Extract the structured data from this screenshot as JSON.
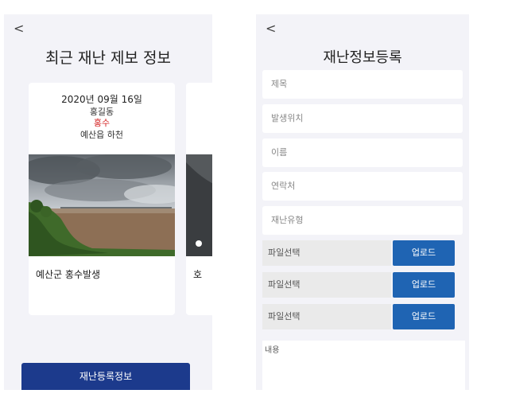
{
  "left": {
    "back": "<",
    "title": "최근 재난 제보 정보",
    "cards": [
      {
        "date": "2020년 09월 16일",
        "name": "홍길동",
        "type": "홍수",
        "location": "예산읍 하천",
        "caption": "예산군 홍수발생"
      },
      {
        "caption": "호"
      }
    ],
    "register_button": "재난등록정보"
  },
  "right": {
    "back": "<",
    "title": "재난정보등록",
    "fields": [
      "제목",
      "발생위치",
      "이름",
      "연락처",
      "재난유형"
    ],
    "files": [
      {
        "label": "파일선택",
        "button": "업로드"
      },
      {
        "label": "파일선택",
        "button": "업로드"
      },
      {
        "label": "파일선택",
        "button": "업로드"
      }
    ],
    "content_placeholder": "내용"
  },
  "colors": {
    "primary_button": "#1c3a8c",
    "upload_button": "#1f64b3",
    "disaster_type": "#d42020",
    "screen_bg": "#f3f3f8"
  }
}
